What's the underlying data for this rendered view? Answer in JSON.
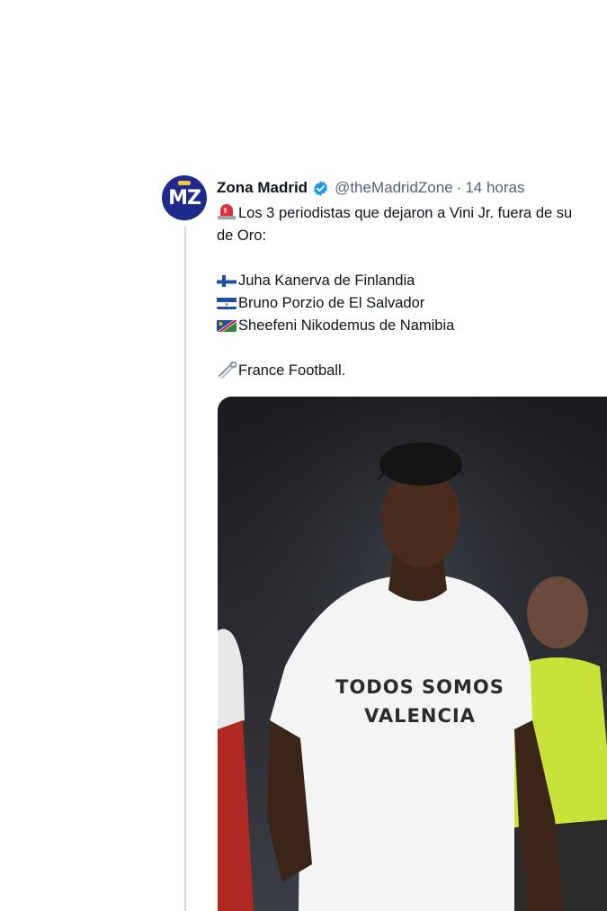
{
  "tweet": {
    "author_name": "Zona Madrid",
    "author_handle": "@theMadridZone",
    "separator": "·",
    "timestamp": "14 horas",
    "avatar_initials": "MZ",
    "verified": true,
    "text": {
      "line1": "Los 3 periodistas que dejaron a Vini Jr. fuera de su",
      "line2": "de Oro:",
      "journalists": [
        "Juha Kanerva de Finlandia",
        "Bruno Porzio de El Salvador",
        "Sheefeni Nikodemus de Namibia"
      ],
      "source": "France Football."
    },
    "image": {
      "shirt_line1": "TODOS SOMOS",
      "shirt_line2": "VALENCIA"
    }
  },
  "colors": {
    "avatar_bg": "#1d2a8c",
    "verified_blue": "#1d9bf0",
    "thread_line": "#cfd9de",
    "muted_text": "#536471"
  },
  "icons": {
    "siren": "rotating-light-icon",
    "flag_finland": "flag-finland-icon",
    "flag_el_salvador": "flag-el-salvador-icon",
    "flag_namibia": "flag-namibia-icon",
    "source": "safety-pin-icon"
  }
}
